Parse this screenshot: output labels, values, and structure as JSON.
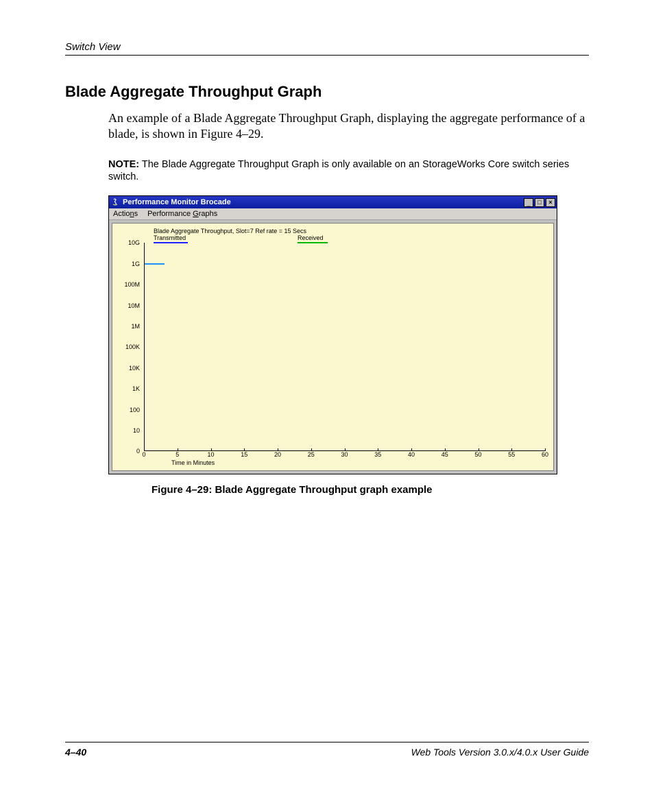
{
  "header": {
    "section": "Switch View"
  },
  "title": "Blade Aggregate Throughput Graph",
  "paragraph": "An example of a Blade Aggregate Throughput Graph, displaying the aggregate performance of a blade, is shown in Figure 4–29.",
  "note": {
    "label": "NOTE:",
    "text": "The Blade Aggregate Throughput Graph is only available on an StorageWorks Core switch series switch."
  },
  "window": {
    "title": "Performance Monitor Brocade",
    "menu": {
      "actions": "Actions",
      "graphs": "Performance Graphs"
    },
    "buttons": {
      "min": "_",
      "max": "□",
      "close": "×"
    }
  },
  "chart_data": {
    "type": "line",
    "title": "Blade Aggregate Throughput, Slot=7 Ref rate = 15 Secs",
    "legend": {
      "transmitted": "Transmitted",
      "received": "Received"
    },
    "xlabel": "Time in Minutes",
    "ylabel": "",
    "x_ticks": [
      "0",
      "5",
      "10",
      "15",
      "20",
      "25",
      "30",
      "35",
      "40",
      "45",
      "50",
      "55",
      "60"
    ],
    "y_ticks": [
      "0",
      "10",
      "100",
      "1K",
      "10K",
      "100K",
      "1M",
      "10M",
      "100M",
      "1G",
      "10G"
    ],
    "xlim": [
      0,
      60
    ],
    "series": [
      {
        "name": "Transmitted",
        "color": "#2020ff",
        "approx_value": "1G",
        "x_range": [
          0,
          3
        ]
      },
      {
        "name": "Received",
        "color": "#00b800",
        "approx_value": "1G",
        "x_range": [
          0,
          3
        ]
      }
    ]
  },
  "caption": "Figure 4–29:  Blade Aggregate Throughput graph example",
  "footer": {
    "page": "4–40",
    "doc": "Web Tools Version 3.0.x/4.0.x User Guide"
  }
}
